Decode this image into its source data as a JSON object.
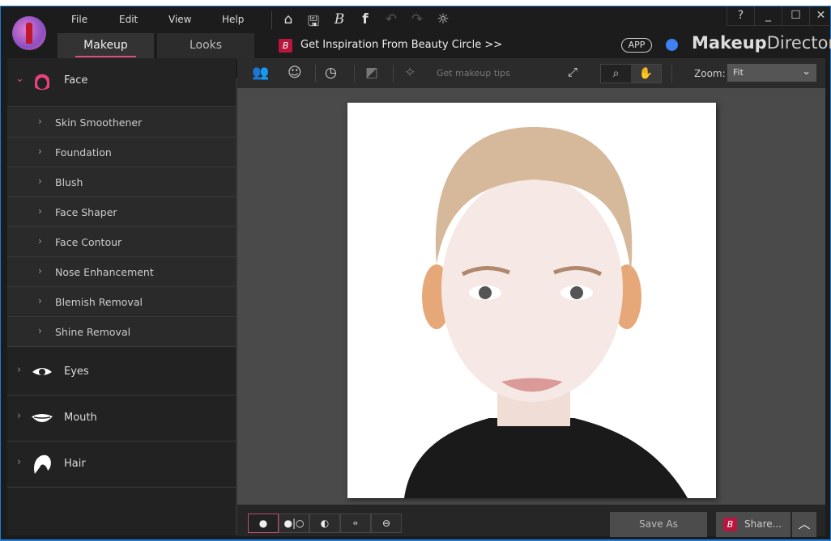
{
  "menu": [
    "File",
    "Edit",
    "View",
    "Help"
  ],
  "toolbar_icons": [
    "home-icon",
    "save-icon",
    "beauty-circle-icon",
    "facebook-icon",
    "undo-icon",
    "redo-icon",
    "settings-icon"
  ],
  "tabs": [
    {
      "label": "Makeup",
      "active": true
    },
    {
      "label": "Looks",
      "active": false
    }
  ],
  "banner": "Get Inspiration From Beauty Circle >>",
  "app_badge": "APP",
  "brand": {
    "bold": "Makeup",
    "light": "Director"
  },
  "window_controls": [
    "?",
    "_",
    "☐",
    "✕"
  ],
  "accent": "#d9507a",
  "sidebar": {
    "face": {
      "label": "Face",
      "items": [
        "Skin Smoothener",
        "Foundation",
        "Blush",
        "Face Shaper",
        "Face Contour",
        "Nose Enhancement",
        "Blemish Removal",
        "Shine Removal"
      ]
    },
    "categories": [
      "Eyes",
      "Mouth",
      "Hair"
    ]
  },
  "edit_toolbar": {
    "tips": "Get makeup tips",
    "zoom_label": "Zoom:",
    "zoom_value": "Fit"
  },
  "bottom": {
    "save_as": "Save As",
    "share": "Share..."
  }
}
